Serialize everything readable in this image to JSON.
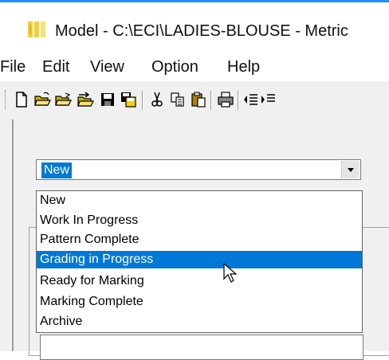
{
  "window": {
    "title": "Model - C:\\ECI\\LADIES-BLOUSE - Metric",
    "icon": "app-icon"
  },
  "menubar": {
    "items": [
      "File",
      "Edit",
      "View",
      "Option",
      "Help"
    ]
  },
  "toolbar": {
    "icons": [
      "new-icon",
      "open-icon",
      "open-alt-icon",
      "import-icon",
      "save-icon",
      "save-all-icon",
      "cut-icon",
      "copy-icon",
      "paste-icon",
      "print-icon",
      "align-left-icon",
      "align-right-icon"
    ]
  },
  "status_combo": {
    "value": "New",
    "options": [
      "New",
      "Work In Progress",
      "Pattern Complete",
      "Grading in Progress",
      "Ready for Marking",
      "Marking  Complete",
      "Archive"
    ],
    "highlighted": "Grading in Progress"
  },
  "colors": {
    "selection": "#0078d7",
    "accent_line": "#1e90ff",
    "window_bg": "#f0f0f0"
  }
}
